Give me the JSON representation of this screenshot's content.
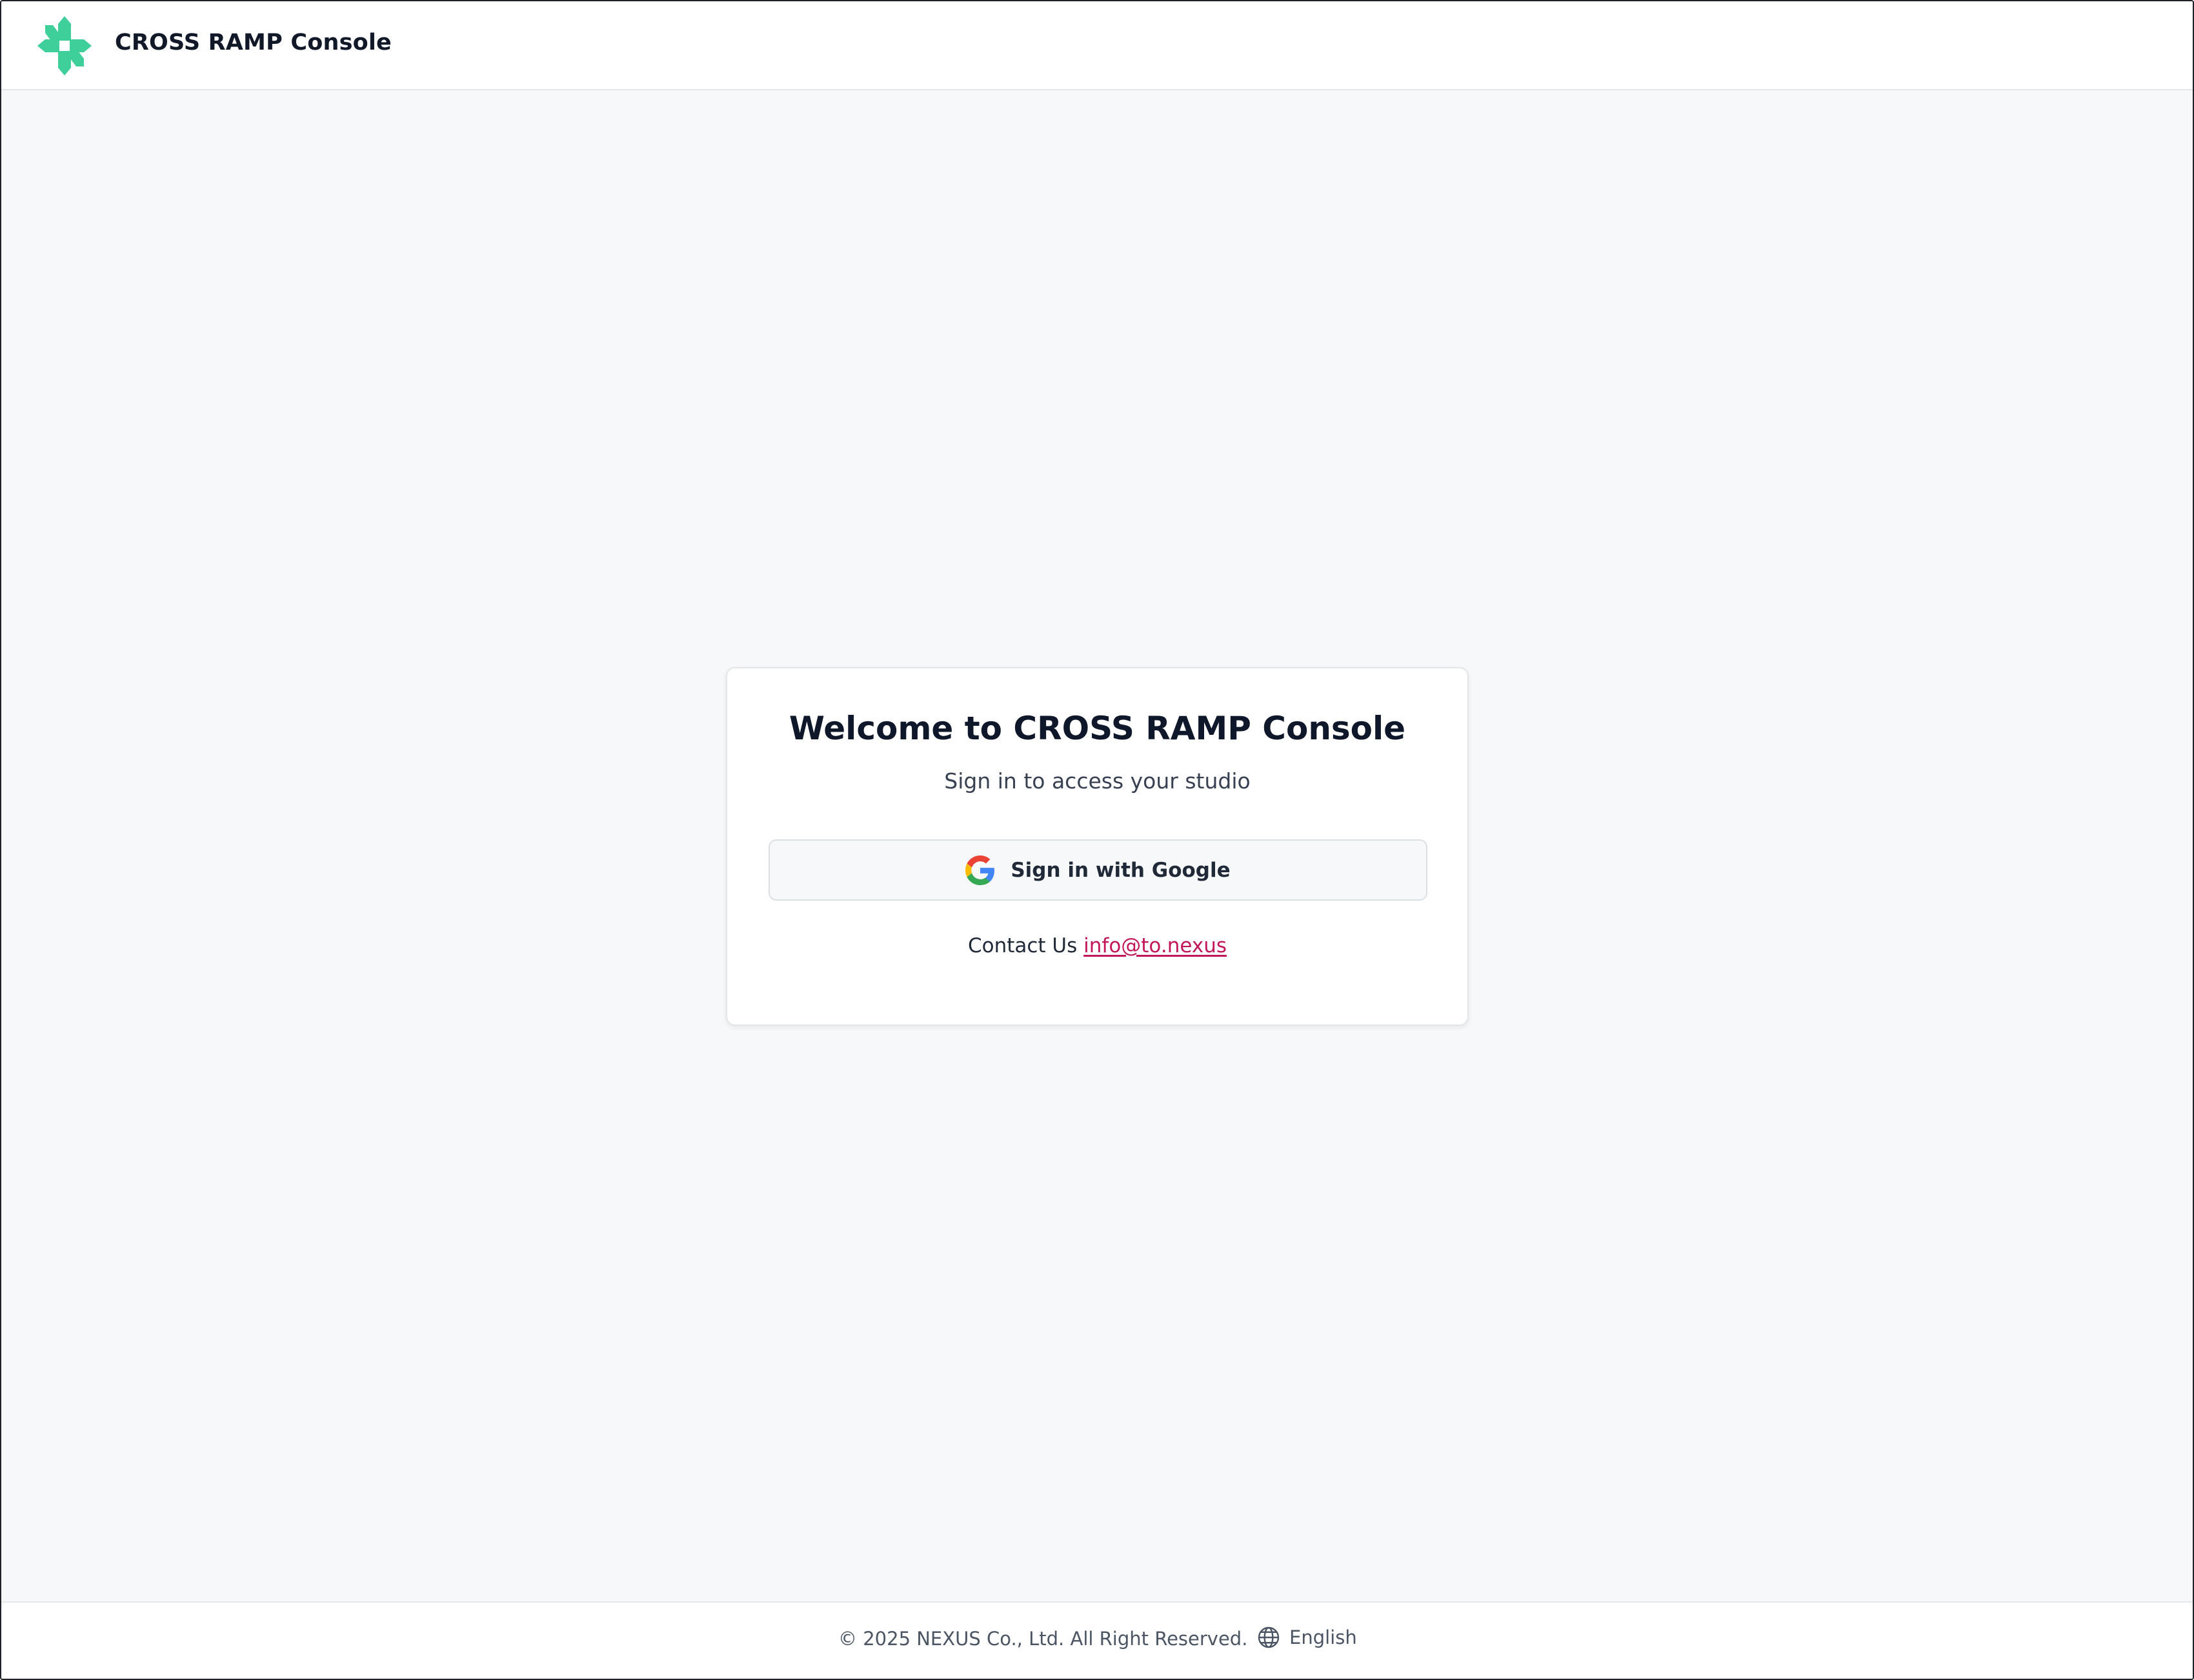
{
  "header": {
    "app_title": "CROSS RAMP Console",
    "logo_icon": "cross-ramp-logo",
    "logo_color": "#3ecf9b"
  },
  "login_card": {
    "title": "Welcome to CROSS RAMP Console",
    "subtitle": "Sign in to access your studio",
    "google_button_label": "Sign in with Google",
    "google_icon": "google-g-icon",
    "contact_label": "Contact Us",
    "contact_email": "info@to.nexus",
    "link_color": "#c2185b"
  },
  "footer": {
    "copyright": "© 2025 NEXUS Co., Ltd. All Right Reserved.",
    "language_label": "English",
    "language_icon": "globe-icon"
  }
}
